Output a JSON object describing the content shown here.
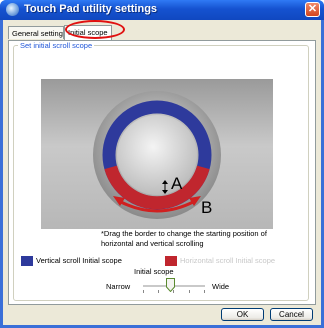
{
  "window": {
    "title": "Touch Pad utility settings",
    "close_glyph": "✕",
    "app_icon": "touchpad-icon"
  },
  "tabs": [
    {
      "label": "General setting",
      "selected": false
    },
    {
      "label": "Initial scope",
      "selected": true,
      "highlighted": true
    }
  ],
  "group": {
    "legend": "Set initial scroll scope"
  },
  "preview": {
    "label_a": "A",
    "label_b": "B",
    "vertical_color": "#2e3a9c",
    "horizontal_color": "#c0262e"
  },
  "note": "*Drag the border to change the starting position of horizontal and vertical scrolling",
  "legend": {
    "vertical": "Vertical scroll Initial scope",
    "horizontal": "Horizontal scroll Initial scope"
  },
  "scope": {
    "title": "Initial scope",
    "min_label": "Narrow",
    "max_label": "Wide",
    "value_fraction": 0.45
  },
  "buttons": {
    "ok": "OK",
    "cancel": "Cancel"
  },
  "colors": {
    "titlebar": "#1552d0",
    "close": "#d2451e",
    "highlight_ring": "#e01010"
  }
}
